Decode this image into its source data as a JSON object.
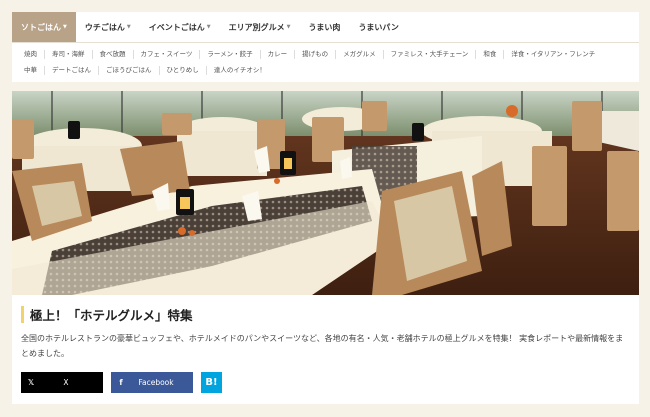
{
  "nav": {
    "main_tabs": [
      {
        "label": "ソトごはん",
        "dropdown": true
      },
      {
        "label": "ウチごはん",
        "dropdown": true
      },
      {
        "label": "イベントごはん",
        "dropdown": true
      },
      {
        "label": "エリア別グルメ",
        "dropdown": true
      },
      {
        "label": "うまい肉",
        "dropdown": false
      },
      {
        "label": "うまいパン",
        "dropdown": false
      }
    ],
    "sub_row1": [
      "焼肉",
      "寿司・海鮮",
      "食べ放題",
      "カフェ・スイーツ",
      "ラーメン・餃子",
      "カレー",
      "揚げもの",
      "メガグルメ",
      "ファミレス・大手チェーン",
      "和食",
      "洋食・イタリアン・フレンチ"
    ],
    "sub_row2": [
      "中華",
      "デートごはん",
      "ごほうびごはん",
      "ひとりめし",
      "達人のイチオシ！"
    ]
  },
  "article": {
    "title": "極上！「ホテルグルメ」特集",
    "description": "全国のホテルレストランの豪華ビュッフェや、ホテルメイドのパンやスイーツなど、各地の有名・人気・老舗ホテルの極上グルメを特集！ 実食レポートや最新情報をまとめました。",
    "hero_alt": "hotel restaurant dining room"
  },
  "share": {
    "x_label": "X",
    "x_icon": "𝕏",
    "facebook_label": "Facebook",
    "facebook_icon": "f",
    "hatena_label": "B!"
  },
  "colors": {
    "active_tab": "#b8a288",
    "title_accent": "#f1d26d",
    "facebook": "#3b5998",
    "hatena": "#00a4de"
  }
}
